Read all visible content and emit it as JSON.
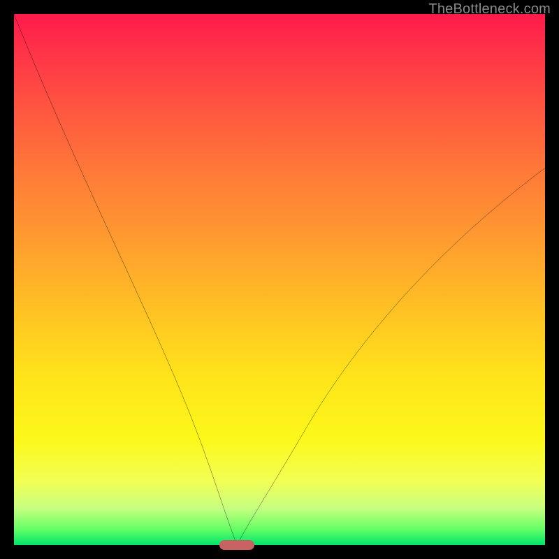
{
  "watermark": "TheBottleneck.com",
  "chart_data": {
    "type": "line",
    "title": "",
    "xlabel": "",
    "ylabel": "",
    "xlim": [
      0,
      100
    ],
    "ylim": [
      0,
      100
    ],
    "grid": false,
    "legend": false,
    "series": [
      {
        "name": "left-branch",
        "x": [
          0,
          5,
          10,
          15,
          20,
          25,
          30,
          35,
          38,
          40,
          41,
          42
        ],
        "y": [
          100,
          88,
          76,
          64,
          52,
          40,
          28,
          16,
          8,
          3,
          1,
          0
        ]
      },
      {
        "name": "right-branch",
        "x": [
          42,
          44,
          46,
          50,
          55,
          60,
          65,
          70,
          75,
          80,
          85,
          90,
          95,
          100
        ],
        "y": [
          0,
          2,
          5,
          12,
          22,
          31,
          39,
          46,
          52,
          57,
          61,
          65,
          68,
          71
        ]
      }
    ],
    "marker": {
      "x": 42,
      "y": 0,
      "color": "#c96262"
    },
    "background_gradient": {
      "top": "#ff1a4b",
      "mid": "#ffe31a",
      "bottom": "#00e46b"
    }
  }
}
